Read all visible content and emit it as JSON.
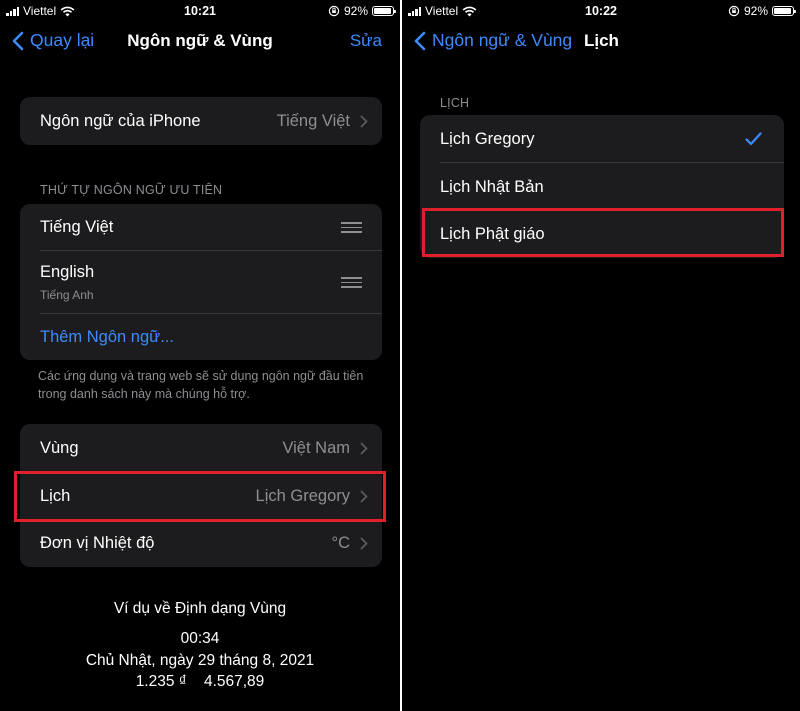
{
  "left": {
    "status": {
      "carrier": "Viettel",
      "time": "10:21",
      "battery": "92%",
      "battery_level": 0.92
    },
    "nav": {
      "back": "Quay lại",
      "title": "Ngôn ngữ & Vùng",
      "action": "Sửa"
    },
    "iphone_language": {
      "label": "Ngôn ngữ của iPhone",
      "value": "Tiếng Việt"
    },
    "preferred": {
      "header": "THỨ TỰ NGÔN NGỮ ƯU TIÊN",
      "items": [
        {
          "label": "Tiếng Việt",
          "sublabel": ""
        },
        {
          "label": "English",
          "sublabel": "Tiếng Anh"
        }
      ],
      "add": "Thêm Ngôn ngữ...",
      "note": "Các ứng dụng và trang web sẽ sử dụng ngôn ngữ đầu tiên trong danh sách này mà chúng hỗ trợ."
    },
    "region_rows": [
      {
        "label": "Vùng",
        "value": "Việt Nam"
      },
      {
        "label": "Lịch",
        "value": "Lịch Gregory"
      },
      {
        "label": "Đơn vị Nhiệt độ",
        "value": "°C"
      }
    ],
    "example": {
      "title": "Ví dụ về Định dạng Vùng",
      "time": "00:34",
      "date": "Chủ Nhật, ngày 29 tháng 8, 2021",
      "numbers": "1.235 ₫    4.567,89"
    }
  },
  "right": {
    "status": {
      "carrier": "Viettel",
      "time": "10:22",
      "battery": "92%",
      "battery_level": 0.92
    },
    "nav": {
      "back": "Ngôn ngữ & Vùng",
      "title": "Lịch"
    },
    "calendar": {
      "header": "LỊCH",
      "items": [
        {
          "label": "Lịch Gregory",
          "selected": true
        },
        {
          "label": "Lịch Nhật Bản",
          "selected": false
        },
        {
          "label": "Lịch Phật giáo",
          "selected": false
        }
      ]
    }
  },
  "colors": {
    "accent": "#3d8bfd",
    "highlight": "#e0202a",
    "cell": "#1c1c1e",
    "secondary": "#8e8e93"
  }
}
